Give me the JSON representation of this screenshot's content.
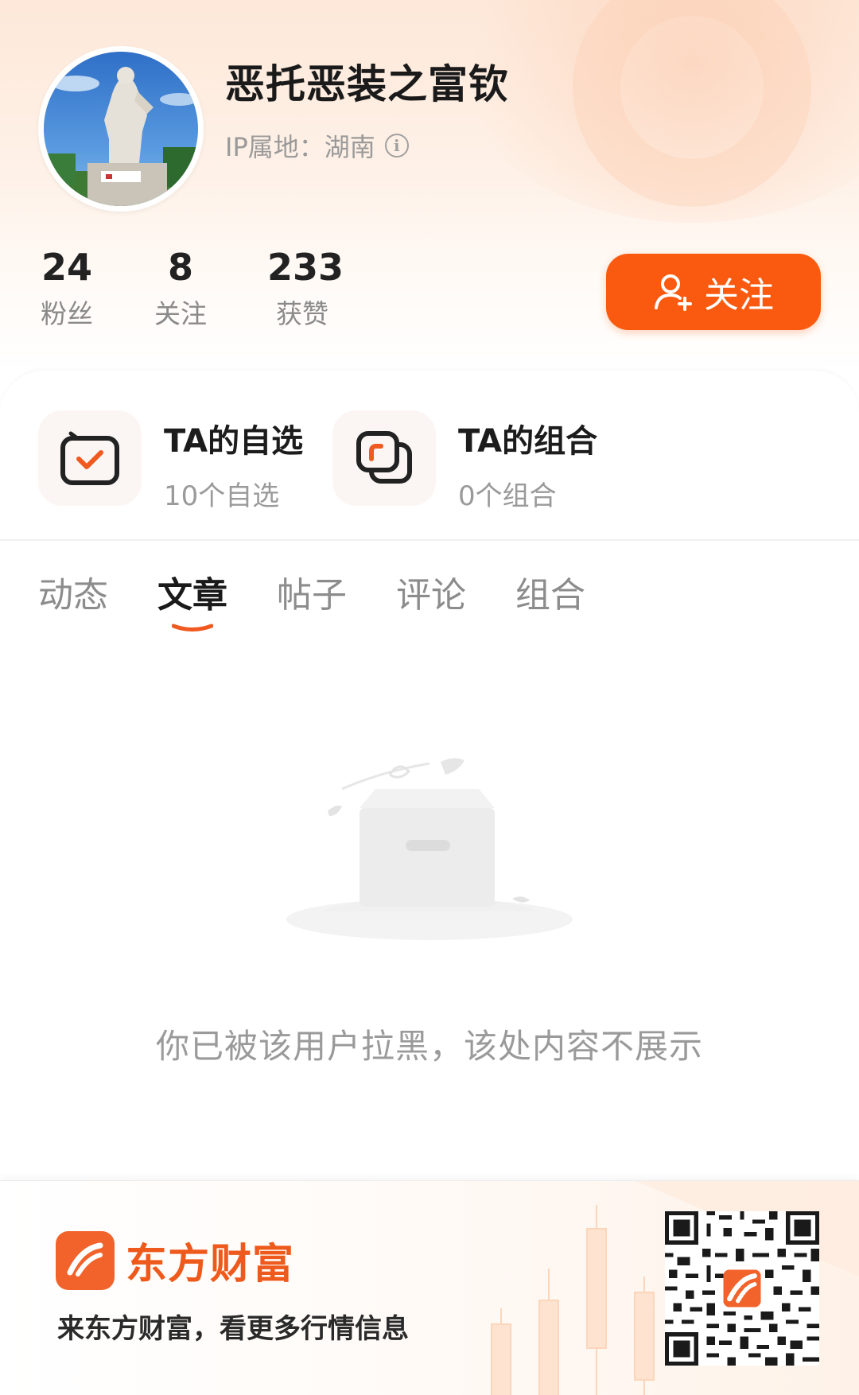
{
  "profile": {
    "nickname": "恶托恶装之富钦",
    "ip_label": "IP属地：",
    "ip_value": "湖南",
    "info_icon": "info-icon"
  },
  "stats": [
    {
      "value": "24",
      "label": "粉丝"
    },
    {
      "value": "8",
      "label": "关注"
    },
    {
      "value": "233",
      "label": "获赞"
    }
  ],
  "follow_button": {
    "label": "关注",
    "icon": "add-user-icon"
  },
  "features": [
    {
      "title": "TA的自选",
      "subtitle": "10个自选",
      "icon": "checkbox-icon"
    },
    {
      "title": "TA的组合",
      "subtitle": "0个组合",
      "icon": "portfolio-icon"
    }
  ],
  "tabs": [
    {
      "label": "动态",
      "active": false
    },
    {
      "label": "文章",
      "active": true
    },
    {
      "label": "帖子",
      "active": false
    },
    {
      "label": "评论",
      "active": false
    },
    {
      "label": "组合",
      "active": false
    }
  ],
  "empty_state": {
    "message": "你已被该用户拉黑，该处内容不展示",
    "illustration": "empty-box-icon"
  },
  "footer": {
    "brand_name": "东方财富",
    "slogan": "来东方财富，看更多行情信息",
    "logo": "eastmoney-logo-icon",
    "qr": "qr-code"
  },
  "colors": {
    "accent": "#fa5a0f",
    "brand": "#ee5a1c",
    "text_primary": "#1a1a1a",
    "text_secondary": "#9a9a9a"
  }
}
